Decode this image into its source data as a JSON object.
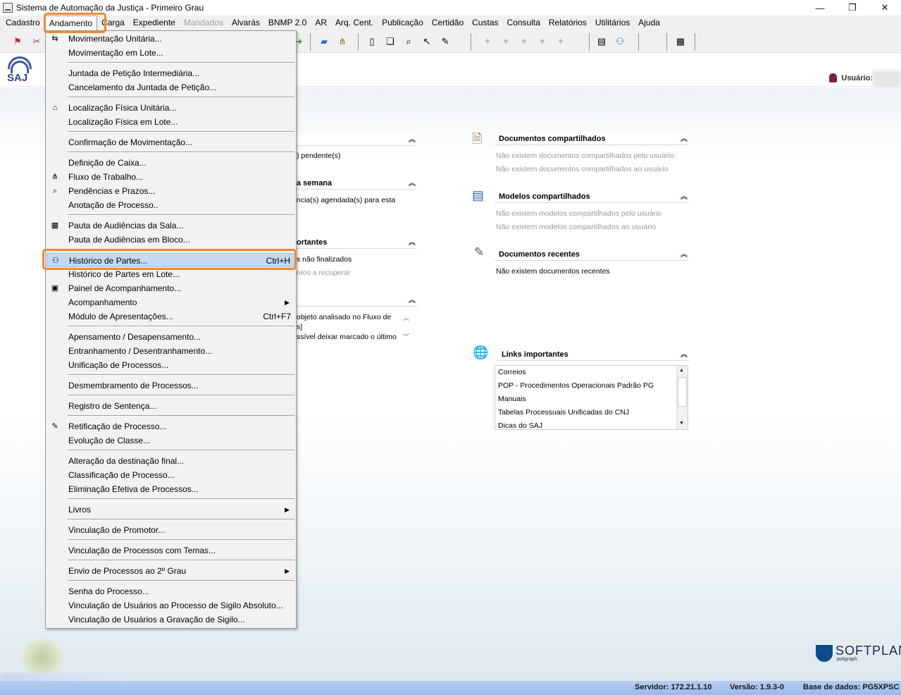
{
  "window": {
    "title": "Sistema de Automação da Justiça - Primeiro Grau",
    "controls": [
      "—",
      "❐",
      "✕"
    ]
  },
  "menubar": [
    "Cadastro",
    "Andamento",
    "Carga",
    "Expediente",
    "Mandados",
    "Alvarás",
    "BNMP 2.0",
    "AR",
    "Arq. Cent.",
    "Publicação",
    "Certidão",
    "Custas",
    "Consulta",
    "Relatórios",
    "Utilitários",
    "Ajuda"
  ],
  "header": {
    "logo_text": "SAJ",
    "user_label": "Usuário:"
  },
  "panels": {
    "left1": {
      "title": "",
      "text": ") pendente(s)"
    },
    "left2": {
      "title": "a semana",
      "text": "ncia(s) agendada(s) para esta"
    },
    "left3": {
      "title": "ortantes",
      "text1": "s não finalizados",
      "text2": "ntos a recuperar"
    },
    "left4": {
      "text1": "objeto analisado no Fluxo de",
      "text2": "s]",
      "text3": "ssível deixar marcado o último"
    },
    "docs_shared": {
      "title": "Documentos compartilhados",
      "line1": "Não existem documentos compartilhados pelo usuário",
      "line2": "Não existem documentos compartilhados ao usuário"
    },
    "models_shared": {
      "title": "Modelos compartilhados",
      "line1": "Não existem modelos compartilhados pelo usuário",
      "line2": "Não existem modelos compartilhados ao usuário"
    },
    "recent_docs": {
      "title": "Documentos recentes",
      "line1": "Não existem documentos recentes"
    },
    "links": {
      "title": "Links importantes",
      "items": [
        "Correios",
        "POP - Procedimentos Operacionais Padrão PG",
        "Manuais",
        "Tabelas Processuais Unificadas do CNJ",
        "Dicas do SAJ"
      ]
    }
  },
  "statusbar": {
    "server": "Servidor: 172.21.1.10",
    "version": "Versão: 1.9.3-0",
    "database": "Base de dados: PG5XPSC"
  },
  "brand": {
    "name": "SOFTPLAN",
    "sub": "poligraph"
  },
  "colors": {
    "highlight_outline": "#ef8a32",
    "menu_highlight": "#c4daf3",
    "statusbar": "#9cbae8"
  },
  "dropdown": {
    "items": [
      {
        "label": "Movimentação Unitária...",
        "icon": "move-icon"
      },
      {
        "label": "Movimentação em Lote..."
      },
      {
        "sep": true
      },
      {
        "label": "Juntada de Petição Intermediária..."
      },
      {
        "label": "Cancelamento da Juntada de Petição..."
      },
      {
        "sep": true
      },
      {
        "label": "Localização Física Unitária...",
        "icon": "location-icon"
      },
      {
        "label": "Localização Física em Lote..."
      },
      {
        "sep": true
      },
      {
        "label": "Confirmação de Movimentação..."
      },
      {
        "sep": true
      },
      {
        "label": "Definição de Caixa..."
      },
      {
        "label": "Fluxo de Trabalho...",
        "icon": "workflow-icon"
      },
      {
        "label": "Pendências e Prazos...",
        "icon": "pending-icon"
      },
      {
        "label": "Anotação de Processo.."
      },
      {
        "sep": true
      },
      {
        "label": "Pauta de Audiências da Sala...",
        "icon": "calendar-icon"
      },
      {
        "label": "Pauta de Audiências em Bloco..."
      },
      {
        "sep": true
      },
      {
        "label": "Histórico de Partes...",
        "shortcut": "Ctrl+H",
        "icon": "history-icon",
        "highlight": true
      },
      {
        "label": "Histórico de Partes em Lote..."
      },
      {
        "label": "Painel de Acompanhamento...",
        "icon": "panel-icon"
      },
      {
        "label": "Acompanhamento",
        "submenu": true
      },
      {
        "label": "Módulo de Apresentações...",
        "shortcut": "Ctrl+F7"
      },
      {
        "sep": true
      },
      {
        "label": "Apensamento / Desapensamento..."
      },
      {
        "label": "Entranhamento / Desentranhamento..."
      },
      {
        "label": "Unificação de Processos..."
      },
      {
        "sep": true
      },
      {
        "label": "Desmembramento de Processos..."
      },
      {
        "sep": true
      },
      {
        "label": "Registro de Sentença..."
      },
      {
        "sep": true
      },
      {
        "label": "Retificação de Processo...",
        "icon": "rectify-icon"
      },
      {
        "label": "Evolução de Classe..."
      },
      {
        "sep": true
      },
      {
        "label": "Alteração da destinação final..."
      },
      {
        "label": "Classificação de Processo..."
      },
      {
        "label": "Eliminação Efetiva de Processos..."
      },
      {
        "sep": true
      },
      {
        "label": "Livros",
        "submenu": true
      },
      {
        "sep": true
      },
      {
        "label": "Vinculação de Promotor..."
      },
      {
        "sep": true
      },
      {
        "label": "Vinculação de Processos com Temas..."
      },
      {
        "sep": true
      },
      {
        "label": "Envio de Processos ao 2º Grau",
        "submenu": true
      },
      {
        "sep": true
      },
      {
        "label": "Senha do Processo..."
      },
      {
        "label": "Vinculação de Usuários ao Processo de Sigilo Absoluto..."
      },
      {
        "label": "Vinculação de Usuários a Gravação de Sigilo..."
      }
    ]
  }
}
